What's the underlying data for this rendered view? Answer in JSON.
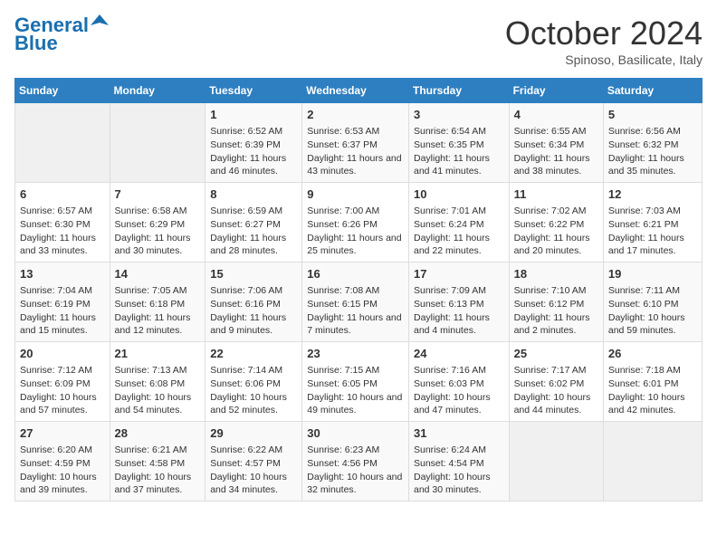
{
  "header": {
    "logo_line1": "General",
    "logo_line2": "Blue",
    "title": "October 2024",
    "subtitle": "Spinoso, Basilicate, Italy"
  },
  "days_of_week": [
    "Sunday",
    "Monday",
    "Tuesday",
    "Wednesday",
    "Thursday",
    "Friday",
    "Saturday"
  ],
  "weeks": [
    [
      {
        "day": "",
        "content": ""
      },
      {
        "day": "",
        "content": ""
      },
      {
        "day": "1",
        "content": "Sunrise: 6:52 AM\nSunset: 6:39 PM\nDaylight: 11 hours and 46 minutes."
      },
      {
        "day": "2",
        "content": "Sunrise: 6:53 AM\nSunset: 6:37 PM\nDaylight: 11 hours and 43 minutes."
      },
      {
        "day": "3",
        "content": "Sunrise: 6:54 AM\nSunset: 6:35 PM\nDaylight: 11 hours and 41 minutes."
      },
      {
        "day": "4",
        "content": "Sunrise: 6:55 AM\nSunset: 6:34 PM\nDaylight: 11 hours and 38 minutes."
      },
      {
        "day": "5",
        "content": "Sunrise: 6:56 AM\nSunset: 6:32 PM\nDaylight: 11 hours and 35 minutes."
      }
    ],
    [
      {
        "day": "6",
        "content": "Sunrise: 6:57 AM\nSunset: 6:30 PM\nDaylight: 11 hours and 33 minutes."
      },
      {
        "day": "7",
        "content": "Sunrise: 6:58 AM\nSunset: 6:29 PM\nDaylight: 11 hours and 30 minutes."
      },
      {
        "day": "8",
        "content": "Sunrise: 6:59 AM\nSunset: 6:27 PM\nDaylight: 11 hours and 28 minutes."
      },
      {
        "day": "9",
        "content": "Sunrise: 7:00 AM\nSunset: 6:26 PM\nDaylight: 11 hours and 25 minutes."
      },
      {
        "day": "10",
        "content": "Sunrise: 7:01 AM\nSunset: 6:24 PM\nDaylight: 11 hours and 22 minutes."
      },
      {
        "day": "11",
        "content": "Sunrise: 7:02 AM\nSunset: 6:22 PM\nDaylight: 11 hours and 20 minutes."
      },
      {
        "day": "12",
        "content": "Sunrise: 7:03 AM\nSunset: 6:21 PM\nDaylight: 11 hours and 17 minutes."
      }
    ],
    [
      {
        "day": "13",
        "content": "Sunrise: 7:04 AM\nSunset: 6:19 PM\nDaylight: 11 hours and 15 minutes."
      },
      {
        "day": "14",
        "content": "Sunrise: 7:05 AM\nSunset: 6:18 PM\nDaylight: 11 hours and 12 minutes."
      },
      {
        "day": "15",
        "content": "Sunrise: 7:06 AM\nSunset: 6:16 PM\nDaylight: 11 hours and 9 minutes."
      },
      {
        "day": "16",
        "content": "Sunrise: 7:08 AM\nSunset: 6:15 PM\nDaylight: 11 hours and 7 minutes."
      },
      {
        "day": "17",
        "content": "Sunrise: 7:09 AM\nSunset: 6:13 PM\nDaylight: 11 hours and 4 minutes."
      },
      {
        "day": "18",
        "content": "Sunrise: 7:10 AM\nSunset: 6:12 PM\nDaylight: 11 hours and 2 minutes."
      },
      {
        "day": "19",
        "content": "Sunrise: 7:11 AM\nSunset: 6:10 PM\nDaylight: 10 hours and 59 minutes."
      }
    ],
    [
      {
        "day": "20",
        "content": "Sunrise: 7:12 AM\nSunset: 6:09 PM\nDaylight: 10 hours and 57 minutes."
      },
      {
        "day": "21",
        "content": "Sunrise: 7:13 AM\nSunset: 6:08 PM\nDaylight: 10 hours and 54 minutes."
      },
      {
        "day": "22",
        "content": "Sunrise: 7:14 AM\nSunset: 6:06 PM\nDaylight: 10 hours and 52 minutes."
      },
      {
        "day": "23",
        "content": "Sunrise: 7:15 AM\nSunset: 6:05 PM\nDaylight: 10 hours and 49 minutes."
      },
      {
        "day": "24",
        "content": "Sunrise: 7:16 AM\nSunset: 6:03 PM\nDaylight: 10 hours and 47 minutes."
      },
      {
        "day": "25",
        "content": "Sunrise: 7:17 AM\nSunset: 6:02 PM\nDaylight: 10 hours and 44 minutes."
      },
      {
        "day": "26",
        "content": "Sunrise: 7:18 AM\nSunset: 6:01 PM\nDaylight: 10 hours and 42 minutes."
      }
    ],
    [
      {
        "day": "27",
        "content": "Sunrise: 6:20 AM\nSunset: 4:59 PM\nDaylight: 10 hours and 39 minutes."
      },
      {
        "day": "28",
        "content": "Sunrise: 6:21 AM\nSunset: 4:58 PM\nDaylight: 10 hours and 37 minutes."
      },
      {
        "day": "29",
        "content": "Sunrise: 6:22 AM\nSunset: 4:57 PM\nDaylight: 10 hours and 34 minutes."
      },
      {
        "day": "30",
        "content": "Sunrise: 6:23 AM\nSunset: 4:56 PM\nDaylight: 10 hours and 32 minutes."
      },
      {
        "day": "31",
        "content": "Sunrise: 6:24 AM\nSunset: 4:54 PM\nDaylight: 10 hours and 30 minutes."
      },
      {
        "day": "",
        "content": ""
      },
      {
        "day": "",
        "content": ""
      }
    ]
  ]
}
